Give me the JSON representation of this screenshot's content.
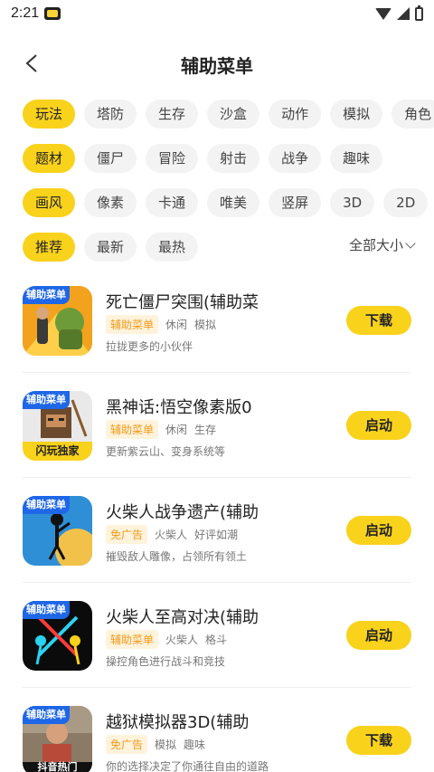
{
  "status_bar": {
    "time": "2:21"
  },
  "header": {
    "title": "辅助菜单"
  },
  "filters": {
    "row1": [
      "玩法",
      "塔防",
      "生存",
      "沙盒",
      "动作",
      "模拟",
      "角色"
    ],
    "row2": [
      "题材",
      "僵尸",
      "冒险",
      "射击",
      "战争",
      "趣味"
    ],
    "row3": [
      "画风",
      "像素",
      "卡通",
      "唯美",
      "竖屏",
      "3D",
      "2D"
    ],
    "row4": [
      "推荐",
      "最新",
      "最热"
    ],
    "size_filter": "全部大小"
  },
  "games": [
    {
      "badge": "辅助菜单",
      "title": "死亡僵尸突围(辅助菜",
      "tag_main": "辅助菜单",
      "tags": [
        "休闲",
        "模拟"
      ],
      "desc": "拉拢更多的小伙伴",
      "action": "下载"
    },
    {
      "badge": "辅助菜单",
      "title": "黑神话:悟空像素版0",
      "tag_main": "辅助菜单",
      "tags": [
        "休闲",
        "生存"
      ],
      "desc": "更新紫云山、变身系统等",
      "action": "启动",
      "thumb_caption": "闪玩独家"
    },
    {
      "badge": "辅助菜单",
      "title": "火柴人战争遗产(辅助",
      "tag_main": "免广告",
      "tags": [
        "火柴人",
        "好评如潮"
      ],
      "desc": "摧毁敌人雕像，占领所有领土",
      "action": "启动"
    },
    {
      "badge": "辅助菜单",
      "title": "火柴人至高对决(辅助",
      "tag_main": "辅助菜单",
      "tags": [
        "火柴人",
        "格斗"
      ],
      "desc": "操控角色进行战斗和竞技",
      "action": "启动"
    },
    {
      "badge": "辅助菜单",
      "title": "越狱模拟器3D(辅助",
      "tag_main": "免广告",
      "tags": [
        "模拟",
        "趣味"
      ],
      "desc": "你的选择决定了你通往自由的道路",
      "action": "下载",
      "thumb_caption": "抖音热门"
    }
  ],
  "colors": {
    "accent": "#f9d21c",
    "badge_blue": "#1e67e6",
    "tag_orange": "#f29a1a"
  }
}
